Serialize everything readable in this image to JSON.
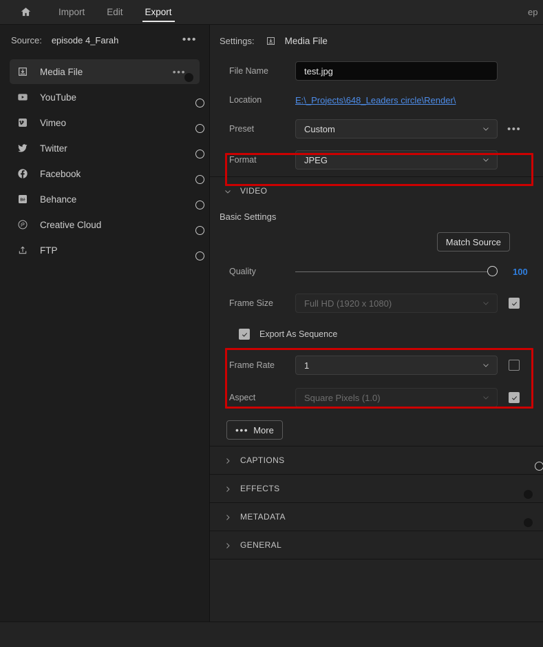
{
  "topbar": {
    "home_icon": "home-icon",
    "tabs": [
      {
        "label": "Import",
        "active": false
      },
      {
        "label": "Edit",
        "active": false
      },
      {
        "label": "Export",
        "active": true
      }
    ],
    "right_text": "ep"
  },
  "sidebar": {
    "source_label": "Source:",
    "source_value": "episode 4_Farah",
    "source_menu": "•••",
    "destinations": [
      {
        "label": "Media File",
        "icon": "media-file-icon",
        "toggle_on": true,
        "selected": true,
        "has_menu": true
      },
      {
        "label": "YouTube",
        "icon": "youtube-icon",
        "toggle_on": false,
        "selected": false,
        "has_menu": false
      },
      {
        "label": "Vimeo",
        "icon": "vimeo-icon",
        "toggle_on": false,
        "selected": false,
        "has_menu": false
      },
      {
        "label": "Twitter",
        "icon": "twitter-icon",
        "toggle_on": false,
        "selected": false,
        "has_menu": false
      },
      {
        "label": "Facebook",
        "icon": "facebook-icon",
        "toggle_on": false,
        "selected": false,
        "has_menu": false
      },
      {
        "label": "Behance",
        "icon": "behance-icon",
        "toggle_on": false,
        "selected": false,
        "has_menu": false
      },
      {
        "label": "Creative Cloud",
        "icon": "creative-cloud-icon",
        "toggle_on": false,
        "selected": false,
        "has_menu": false
      },
      {
        "label": "FTP",
        "icon": "ftp-upload-icon",
        "toggle_on": false,
        "selected": false,
        "has_menu": false
      }
    ]
  },
  "settings": {
    "header_label": "Settings:",
    "header_icon": "media-file-icon",
    "header_value": "Media File",
    "file_name": {
      "label": "File Name",
      "value": "test.jpg"
    },
    "location": {
      "label": "Location",
      "value": "E:\\_Projects\\648_Leaders circle\\Render\\"
    },
    "preset": {
      "label": "Preset",
      "value": "Custom",
      "menu": "•••"
    },
    "format": {
      "label": "Format",
      "value": "JPEG",
      "highlighted": true
    }
  },
  "video_section": {
    "title": "VIDEO",
    "expanded": true,
    "basic_settings_title": "Basic Settings",
    "match_source_button": "Match Source",
    "quality": {
      "label": "Quality",
      "value": "100",
      "percent": 100
    },
    "frame_size": {
      "label": "Frame Size",
      "value": "Full HD (1920 x 1080)",
      "disabled": true,
      "checked": true
    },
    "export_as_sequence": {
      "label": "Export As Sequence",
      "checked": true,
      "highlighted": true
    },
    "frame_rate": {
      "label": "Frame Rate",
      "value": "1",
      "disabled": false,
      "checked": false,
      "highlighted": true
    },
    "aspect": {
      "label": "Aspect",
      "value": "Square Pixels (1.0)",
      "disabled": true,
      "checked": true
    },
    "more_button": "More"
  },
  "collapsed_sections": [
    {
      "title": "CAPTIONS",
      "toggle": true,
      "toggle_on": false
    },
    {
      "title": "EFFECTS",
      "toggle": true,
      "toggle_on": true
    },
    {
      "title": "METADATA",
      "toggle": true,
      "toggle_on": true
    },
    {
      "title": "GENERAL",
      "toggle": false,
      "toggle_on": false
    }
  ],
  "colors": {
    "accent_blue": "#2680eb",
    "link_blue": "#4d8ce8",
    "value_blue": "#2f7fe0",
    "highlight_red": "#cc0000",
    "panel_bg": "#232323",
    "sidebar_bg": "#1d1d1d"
  }
}
